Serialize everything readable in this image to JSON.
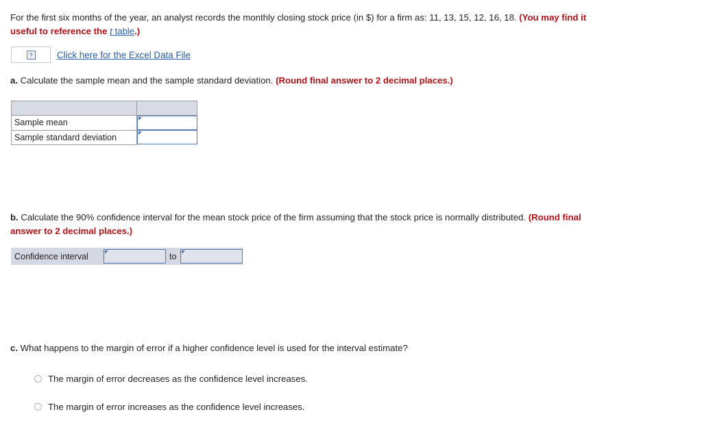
{
  "question": {
    "intro_text_1": "For the first six months of the year, an analyst records the monthly closing stock price (in $) for a firm as: 11, 13, 15, 12, 16, 18. ",
    "intro_emphasis_1": "(You may find it useful to reference the ",
    "intro_link_italic": "t",
    "intro_link_rest": " table",
    "intro_emphasis_2": ".)",
    "data_values": "11, 13, 15, 12, 16, 18"
  },
  "excel": {
    "icon_label": "?",
    "link_text": "Click here for the Excel Data File"
  },
  "parts": {
    "a": {
      "letter": "a.",
      "text": " Calculate the sample mean and the sample standard deviation. ",
      "emphasis": "(Round final answer to 2 decimal places.)"
    },
    "b": {
      "letter": "b.",
      "text": " Calculate the 90% confidence interval for the mean stock price of the firm assuming that the stock price is normally distributed. ",
      "emphasis": "(Round final answer to 2 decimal places.)"
    },
    "c": {
      "letter": "c.",
      "text": " What happens to the margin of error if a higher confidence level is used for the interval estimate?"
    }
  },
  "table_a": {
    "header": [
      "",
      ""
    ],
    "rows": [
      {
        "label": "Sample mean",
        "value": ""
      },
      {
        "label": "Sample standard deviation",
        "value": ""
      }
    ]
  },
  "table_b": {
    "label": "Confidence interval",
    "separator": "to",
    "lower_value": "",
    "upper_value": ""
  },
  "choices": [
    {
      "label": "The margin of error decreases as the confidence level increases.",
      "selected": false
    },
    {
      "label": "The margin of error increases as the confidence level increases.",
      "selected": false
    }
  ],
  "colors": {
    "link": "#2b5faa",
    "emphasis_red": "#b11116",
    "table_header_fill": "#d6dbe6",
    "input_border": "#5176ad",
    "input_shaded_fill": "#dfe3eb",
    "ci_row_fill": "#d3d8e2",
    "text": "#231f20"
  }
}
